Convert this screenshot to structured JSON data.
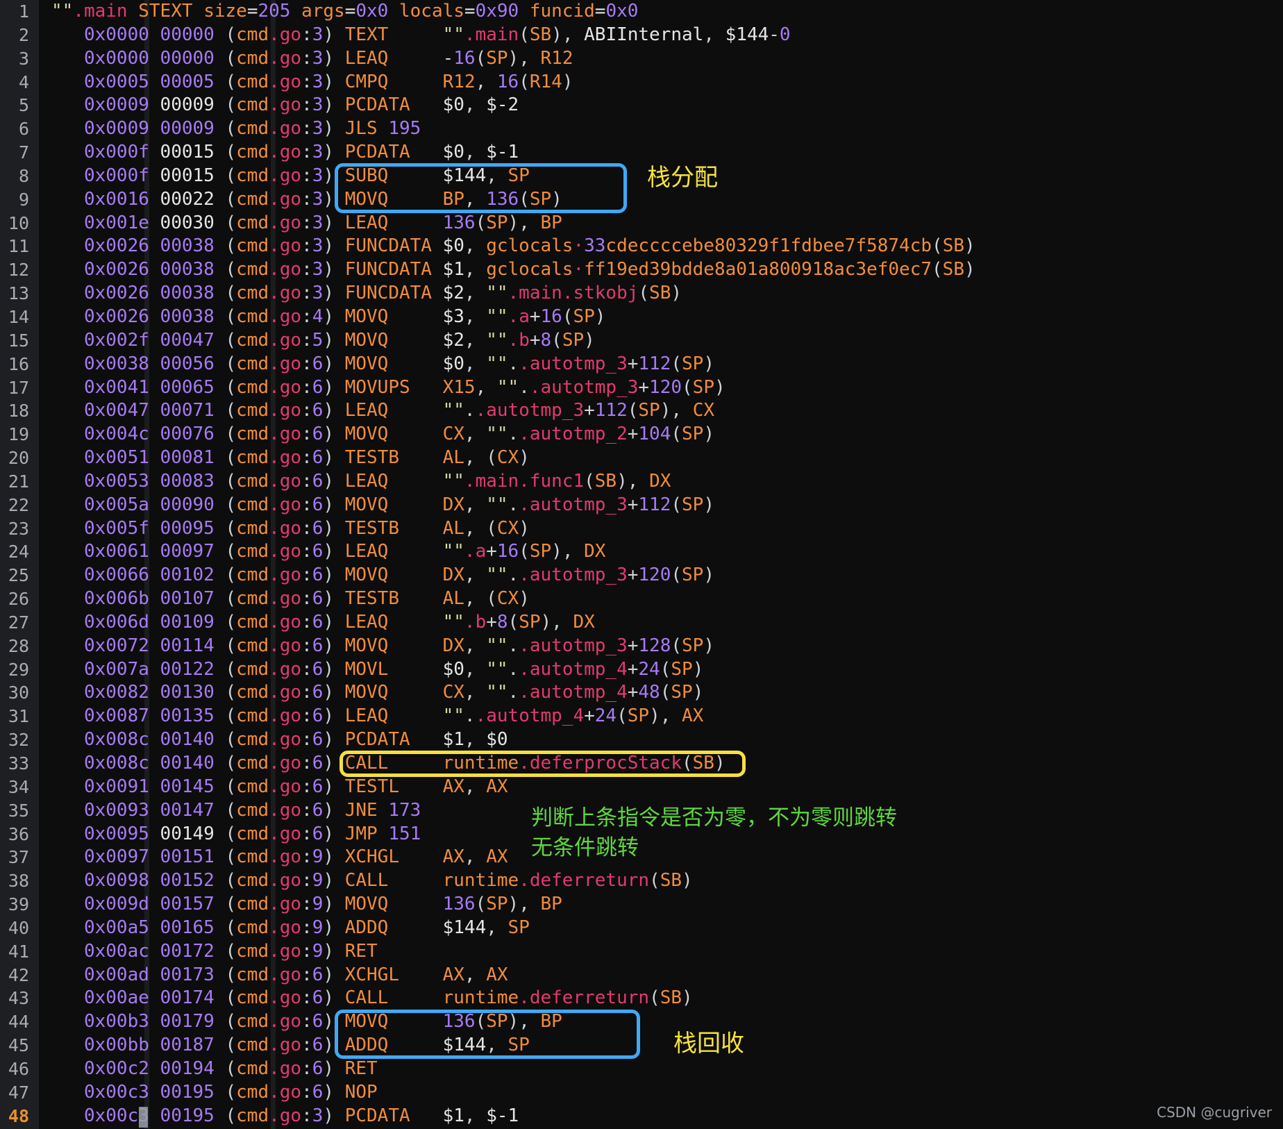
{
  "editor": {
    "background": "#0d0d0e",
    "gutter_background": "#1e1f22",
    "active_line": 48,
    "total_lines": 48
  },
  "watermark": "CSDN @cugriver",
  "header_line": {
    "symbol": "\"\".main",
    "text": "STEXT size=205 args=0x0 locals=0x90 funcid=0x0"
  },
  "lines": [
    {
      "n": 1,
      "raw": "\"\".main STEXT size=205 args=0x0 locals=0x90 funcid=0x0"
    },
    {
      "n": 2,
      "addr": "0x0000",
      "off": "00000",
      "file": "cmd.go",
      "fline": "3",
      "mn": "TEXT",
      "ops": "\"\".main(SB), ABIInternal, $144-0"
    },
    {
      "n": 3,
      "addr": "0x0000",
      "off": "00000",
      "file": "cmd.go",
      "fline": "3",
      "mn": "LEAQ",
      "ops": "-16(SP), R12"
    },
    {
      "n": 4,
      "addr": "0x0005",
      "off": "00005",
      "file": "cmd.go",
      "fline": "3",
      "mn": "CMPQ",
      "ops": "R12, 16(R14)"
    },
    {
      "n": 5,
      "addr": "0x0009",
      "off": "00009",
      "file": "cmd.go",
      "fline": "3",
      "mn": "PCDATA",
      "ops": "$0, $-2"
    },
    {
      "n": 6,
      "addr": "0x0009",
      "off": "00009",
      "file": "cmd.go",
      "fline": "3",
      "mn": "JLS 195",
      "ops": ""
    },
    {
      "n": 7,
      "addr": "0x000f",
      "off": "00015",
      "file": "cmd.go",
      "fline": "3",
      "mn": "PCDATA",
      "ops": "$0, $-1"
    },
    {
      "n": 8,
      "addr": "0x000f",
      "off": "00015",
      "file": "cmd.go",
      "fline": "3",
      "mn": "SUBQ",
      "ops": "$144, SP"
    },
    {
      "n": 9,
      "addr": "0x0016",
      "off": "00022",
      "file": "cmd.go",
      "fline": "3",
      "mn": "MOVQ",
      "ops": "BP, 136(SP)"
    },
    {
      "n": 10,
      "addr": "0x001e",
      "off": "00030",
      "file": "cmd.go",
      "fline": "3",
      "mn": "LEAQ",
      "ops": "136(SP), BP"
    },
    {
      "n": 11,
      "addr": "0x0026",
      "off": "00038",
      "file": "cmd.go",
      "fline": "3",
      "mn": "FUNCDATA",
      "ops": "$0, gclocals·33cdeccccebe80329f1fdbee7f5874cb(SB)"
    },
    {
      "n": 12,
      "addr": "0x0026",
      "off": "00038",
      "file": "cmd.go",
      "fline": "3",
      "mn": "FUNCDATA",
      "ops": "$1, gclocals·ff19ed39bdde8a01a800918ac3ef0ec7(SB)"
    },
    {
      "n": 13,
      "addr": "0x0026",
      "off": "00038",
      "file": "cmd.go",
      "fline": "3",
      "mn": "FUNCDATA",
      "ops": "$2, \"\".main.stkobj(SB)"
    },
    {
      "n": 14,
      "addr": "0x0026",
      "off": "00038",
      "file": "cmd.go",
      "fline": "4",
      "mn": "MOVQ",
      "ops": "$3, \"\".a+16(SP)"
    },
    {
      "n": 15,
      "addr": "0x002f",
      "off": "00047",
      "file": "cmd.go",
      "fline": "5",
      "mn": "MOVQ",
      "ops": "$2, \"\".b+8(SP)"
    },
    {
      "n": 16,
      "addr": "0x0038",
      "off": "00056",
      "file": "cmd.go",
      "fline": "6",
      "mn": "MOVQ",
      "ops": "$0, \"\"..autotmp_3+112(SP)"
    },
    {
      "n": 17,
      "addr": "0x0041",
      "off": "00065",
      "file": "cmd.go",
      "fline": "6",
      "mn": "MOVUPS",
      "ops": "X15, \"\"..autotmp_3+120(SP)"
    },
    {
      "n": 18,
      "addr": "0x0047",
      "off": "00071",
      "file": "cmd.go",
      "fline": "6",
      "mn": "LEAQ",
      "ops": "\"\"..autotmp_3+112(SP), CX"
    },
    {
      "n": 19,
      "addr": "0x004c",
      "off": "00076",
      "file": "cmd.go",
      "fline": "6",
      "mn": "MOVQ",
      "ops": "CX, \"\"..autotmp_2+104(SP)"
    },
    {
      "n": 20,
      "addr": "0x0051",
      "off": "00081",
      "file": "cmd.go",
      "fline": "6",
      "mn": "TESTB",
      "ops": "AL, (CX)"
    },
    {
      "n": 21,
      "addr": "0x0053",
      "off": "00083",
      "file": "cmd.go",
      "fline": "6",
      "mn": "LEAQ",
      "ops": "\"\".main.func1(SB), DX"
    },
    {
      "n": 22,
      "addr": "0x005a",
      "off": "00090",
      "file": "cmd.go",
      "fline": "6",
      "mn": "MOVQ",
      "ops": "DX, \"\"..autotmp_3+112(SP)"
    },
    {
      "n": 23,
      "addr": "0x005f",
      "off": "00095",
      "file": "cmd.go",
      "fline": "6",
      "mn": "TESTB",
      "ops": "AL, (CX)"
    },
    {
      "n": 24,
      "addr": "0x0061",
      "off": "00097",
      "file": "cmd.go",
      "fline": "6",
      "mn": "LEAQ",
      "ops": "\"\".a+16(SP), DX"
    },
    {
      "n": 25,
      "addr": "0x0066",
      "off": "00102",
      "file": "cmd.go",
      "fline": "6",
      "mn": "MOVQ",
      "ops": "DX, \"\"..autotmp_3+120(SP)"
    },
    {
      "n": 26,
      "addr": "0x006b",
      "off": "00107",
      "file": "cmd.go",
      "fline": "6",
      "mn": "TESTB",
      "ops": "AL, (CX)"
    },
    {
      "n": 27,
      "addr": "0x006d",
      "off": "00109",
      "file": "cmd.go",
      "fline": "6",
      "mn": "LEAQ",
      "ops": "\"\".b+8(SP), DX"
    },
    {
      "n": 28,
      "addr": "0x0072",
      "off": "00114",
      "file": "cmd.go",
      "fline": "6",
      "mn": "MOVQ",
      "ops": "DX, \"\"..autotmp_3+128(SP)"
    },
    {
      "n": 29,
      "addr": "0x007a",
      "off": "00122",
      "file": "cmd.go",
      "fline": "6",
      "mn": "MOVL",
      "ops": "$0, \"\"..autotmp_4+24(SP)"
    },
    {
      "n": 30,
      "addr": "0x0082",
      "off": "00130",
      "file": "cmd.go",
      "fline": "6",
      "mn": "MOVQ",
      "ops": "CX, \"\"..autotmp_4+48(SP)"
    },
    {
      "n": 31,
      "addr": "0x0087",
      "off": "00135",
      "file": "cmd.go",
      "fline": "6",
      "mn": "LEAQ",
      "ops": "\"\"..autotmp_4+24(SP), AX"
    },
    {
      "n": 32,
      "addr": "0x008c",
      "off": "00140",
      "file": "cmd.go",
      "fline": "6",
      "mn": "PCDATA",
      "ops": "$1, $0"
    },
    {
      "n": 33,
      "addr": "0x008c",
      "off": "00140",
      "file": "cmd.go",
      "fline": "6",
      "mn": "CALL",
      "ops": "runtime.deferprocStack(SB)"
    },
    {
      "n": 34,
      "addr": "0x0091",
      "off": "00145",
      "file": "cmd.go",
      "fline": "6",
      "mn": "TESTL",
      "ops": "AX, AX"
    },
    {
      "n": 35,
      "addr": "0x0093",
      "off": "00147",
      "file": "cmd.go",
      "fline": "6",
      "mn": "JNE 173",
      "ops": ""
    },
    {
      "n": 36,
      "addr": "0x0095",
      "off": "00149",
      "file": "cmd.go",
      "fline": "6",
      "mn": "JMP 151",
      "ops": ""
    },
    {
      "n": 37,
      "addr": "0x0097",
      "off": "00151",
      "file": "cmd.go",
      "fline": "9",
      "mn": "XCHGL",
      "ops": "AX, AX"
    },
    {
      "n": 38,
      "addr": "0x0098",
      "off": "00152",
      "file": "cmd.go",
      "fline": "9",
      "mn": "CALL",
      "ops": "runtime.deferreturn(SB)"
    },
    {
      "n": 39,
      "addr": "0x009d",
      "off": "00157",
      "file": "cmd.go",
      "fline": "9",
      "mn": "MOVQ",
      "ops": "136(SP), BP"
    },
    {
      "n": 40,
      "addr": "0x00a5",
      "off": "00165",
      "file": "cmd.go",
      "fline": "9",
      "mn": "ADDQ",
      "ops": "$144, SP"
    },
    {
      "n": 41,
      "addr": "0x00ac",
      "off": "00172",
      "file": "cmd.go",
      "fline": "9",
      "mn": "RET",
      "ops": ""
    },
    {
      "n": 42,
      "addr": "0x00ad",
      "off": "00173",
      "file": "cmd.go",
      "fline": "6",
      "mn": "XCHGL",
      "ops": "AX, AX"
    },
    {
      "n": 43,
      "addr": "0x00ae",
      "off": "00174",
      "file": "cmd.go",
      "fline": "6",
      "mn": "CALL",
      "ops": "runtime.deferreturn(SB)"
    },
    {
      "n": 44,
      "addr": "0x00b3",
      "off": "00179",
      "file": "cmd.go",
      "fline": "6",
      "mn": "MOVQ",
      "ops": "136(SP), BP"
    },
    {
      "n": 45,
      "addr": "0x00bb",
      "off": "00187",
      "file": "cmd.go",
      "fline": "6",
      "mn": "ADDQ",
      "ops": "$144, SP"
    },
    {
      "n": 46,
      "addr": "0x00c2",
      "off": "00194",
      "file": "cmd.go",
      "fline": "6",
      "mn": "RET",
      "ops": ""
    },
    {
      "n": 47,
      "addr": "0x00c3",
      "off": "00195",
      "file": "cmd.go",
      "fline": "6",
      "mn": "NOP",
      "ops": ""
    },
    {
      "n": 48,
      "addr": "0x00c3",
      "off": "00195",
      "file": "cmd.go",
      "fline": "3",
      "mn": "PCDATA",
      "ops": "$1, $-1"
    }
  ],
  "annotations": [
    {
      "id": "stack-alloc",
      "text": "栈分配",
      "color": "#f5e33c",
      "kind": "yellow-text"
    },
    {
      "id": "stack-free",
      "text": "栈回收",
      "color": "#f5e33c",
      "kind": "yellow-text"
    },
    {
      "id": "jne-note",
      "text": "判断上条指令是否为零，不为零则跳转",
      "color": "#5fd73f",
      "kind": "green-text"
    },
    {
      "id": "jmp-note",
      "text": "无条件跳转",
      "color": "#5fd73f",
      "kind": "green-text"
    }
  ],
  "highlight_boxes": [
    {
      "id": "stack-alloc-box",
      "color": "#3fa9f5",
      "lines": [
        8,
        9
      ],
      "label": "SUBQ/MOVQ stack allocation"
    },
    {
      "id": "deferproc-box",
      "color": "#f7e03c",
      "lines": [
        33
      ],
      "label": "CALL runtime.deferprocStack(SB)"
    },
    {
      "id": "stack-free-box",
      "color": "#3fa9f5",
      "lines": [
        44,
        45
      ],
      "label": "MOVQ/ADDQ stack reclaim"
    }
  ]
}
